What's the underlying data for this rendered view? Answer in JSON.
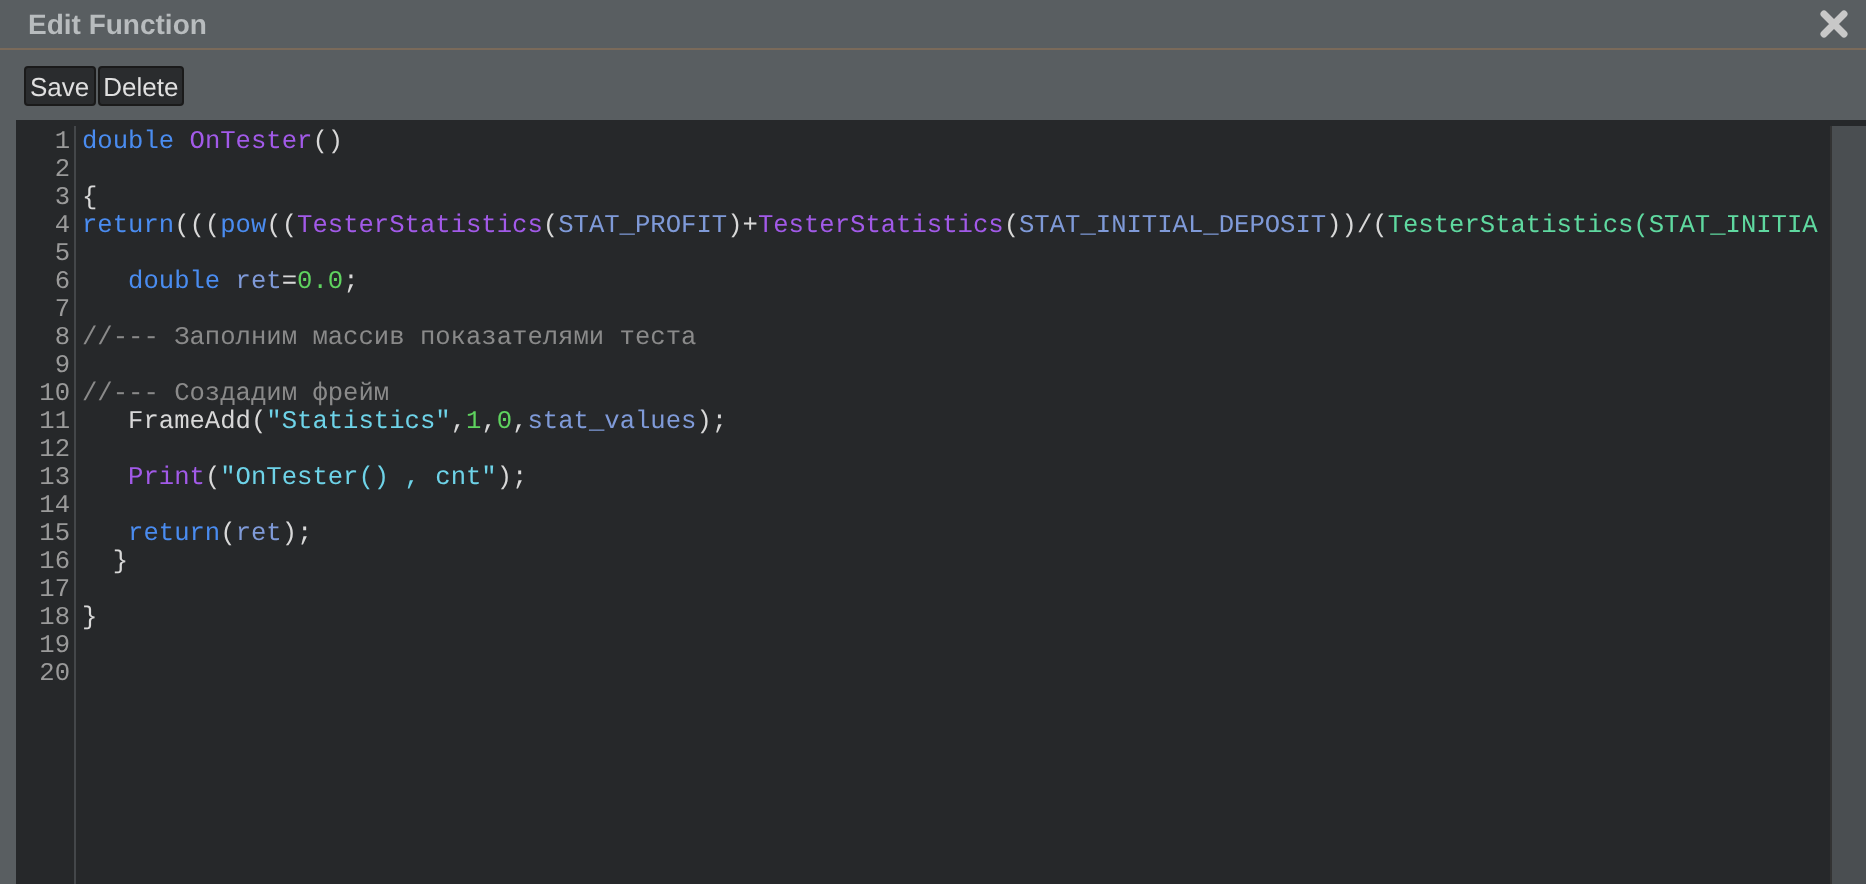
{
  "window": {
    "title": "Edit Function"
  },
  "toolbar": {
    "buttons": [
      "Save",
      "Delete"
    ]
  },
  "editor": {
    "lines": [
      {
        "number": "1",
        "tokens": [
          {
            "kind": "keyword",
            "text": "double "
          },
          {
            "kind": "function",
            "text": "OnTester"
          },
          {
            "kind": "plain",
            "text": "()"
          }
        ]
      },
      {
        "number": "2"
      },
      {
        "number": "3",
        "tokens": [
          {
            "kind": "plain",
            "text": "{"
          }
        ]
      },
      {
        "number": "4",
        "tokens": [
          {
            "kind": "keyword",
            "text": "return"
          },
          {
            "kind": "plain",
            "text": "((("
          },
          {
            "kind": "keyword",
            "text": "pow"
          },
          {
            "kind": "plain",
            "text": "(("
          },
          {
            "kind": "function",
            "text": "TesterStatistics"
          },
          {
            "kind": "plain",
            "text": "("
          },
          {
            "kind": "constant",
            "text": "STAT_PROFIT"
          },
          {
            "kind": "plain",
            "text": ")+"
          },
          {
            "kind": "function",
            "text": "TesterStatistics"
          },
          {
            "kind": "plain",
            "text": "("
          },
          {
            "kind": "constant",
            "text": "STAT_INITIAL_DEPOSIT"
          },
          {
            "kind": "plain",
            "text": "))/("
          },
          {
            "kind": "builtin",
            "text": "TesterStatistics(STAT_INITIA"
          }
        ]
      },
      {
        "number": "5"
      },
      {
        "number": "6",
        "tokens": [
          {
            "kind": "keyword",
            "text": "   double "
          },
          {
            "kind": "constant",
            "text": "ret"
          },
          {
            "kind": "plain",
            "text": "="
          },
          {
            "kind": "number",
            "text": "0.0"
          },
          {
            "kind": "plain",
            "text": ";"
          }
        ]
      },
      {
        "number": "7"
      },
      {
        "number": "8",
        "tokens": [
          {
            "kind": "comment",
            "text": "//--- Заполним массив показателями теста"
          }
        ]
      },
      {
        "number": "9"
      },
      {
        "number": "10",
        "tokens": [
          {
            "kind": "comment",
            "text": "//--- Создадим фрейм"
          }
        ]
      },
      {
        "number": "11",
        "tokens": [
          {
            "kind": "plain",
            "text": "   FrameAdd("
          },
          {
            "kind": "string",
            "text": "\"Statistics\""
          },
          {
            "kind": "plain",
            "text": ","
          },
          {
            "kind": "number",
            "text": "1"
          },
          {
            "kind": "plain",
            "text": ","
          },
          {
            "kind": "number",
            "text": "0"
          },
          {
            "kind": "plain",
            "text": ","
          },
          {
            "kind": "constant",
            "text": "stat_values"
          },
          {
            "kind": "plain",
            "text": ");"
          }
        ]
      },
      {
        "number": "12"
      },
      {
        "number": "13",
        "tokens": [
          {
            "kind": "function",
            "text": "   Print"
          },
          {
            "kind": "plain",
            "text": "("
          },
          {
            "kind": "string",
            "text": "\"OnTester() , cnt\""
          },
          {
            "kind": "plain",
            "text": ");"
          }
        ]
      },
      {
        "number": "14"
      },
      {
        "number": "15",
        "tokens": [
          {
            "kind": "keyword",
            "text": "   return"
          },
          {
            "kind": "plain",
            "text": "("
          },
          {
            "kind": "constant",
            "text": "ret"
          },
          {
            "kind": "plain",
            "text": ");"
          }
        ]
      },
      {
        "number": "16",
        "tokens": [
          {
            "kind": "plain",
            "text": "  }"
          }
        ]
      },
      {
        "number": "17"
      },
      {
        "number": "18",
        "tokens": [
          {
            "kind": "plain",
            "text": "}"
          }
        ]
      },
      {
        "number": "19"
      },
      {
        "number": "20"
      }
    ]
  }
}
